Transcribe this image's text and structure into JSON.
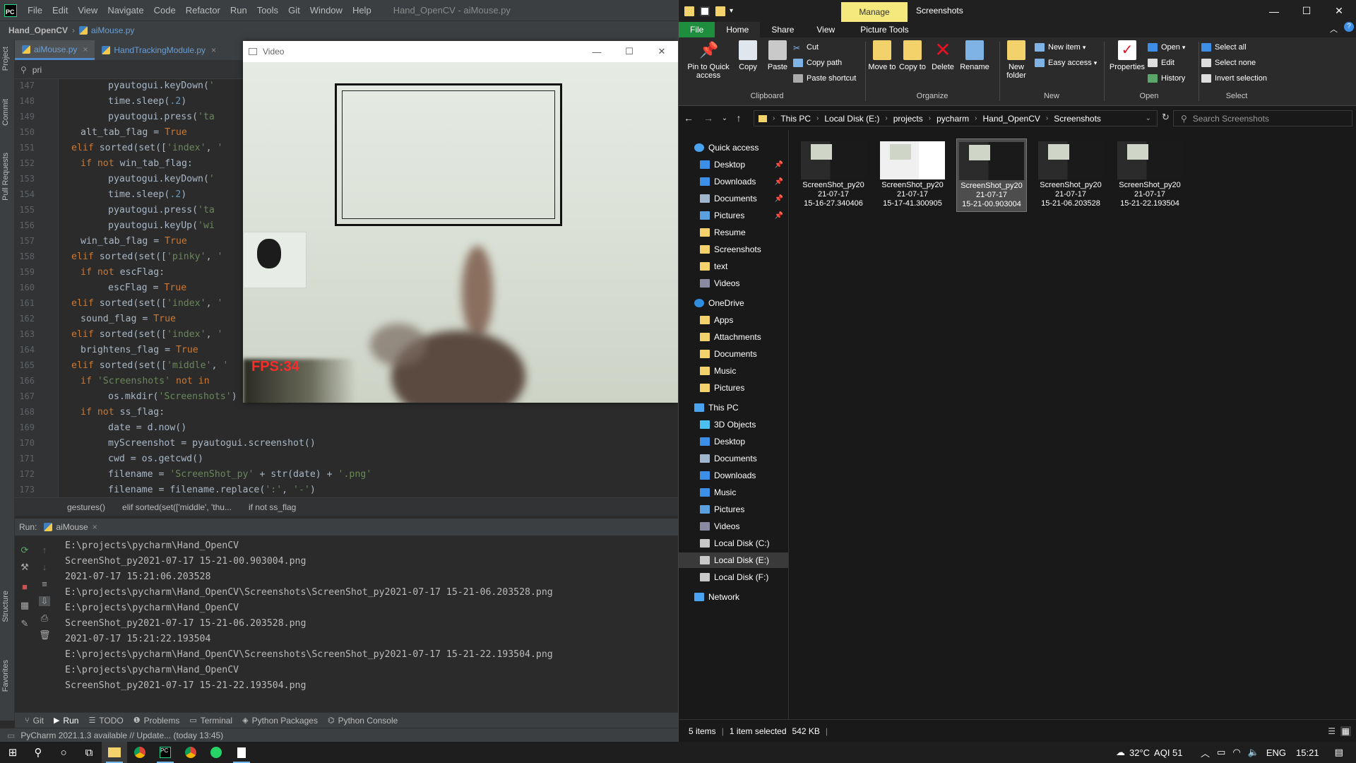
{
  "pycharm": {
    "menu": [
      "File",
      "Edit",
      "View",
      "Navigate",
      "Code",
      "Refactor",
      "Run",
      "Tools",
      "Git",
      "Window",
      "Help"
    ],
    "window_title": "Hand_OpenCV - aiMouse.py",
    "nav": {
      "project": "Hand_OpenCV",
      "file": "aiMouse.py"
    },
    "left_tabs": [
      "Project",
      "Commit",
      "Pull Requests",
      "Structure",
      "Favorites"
    ],
    "tabs": [
      {
        "label": "aiMouse.py",
        "active": true
      },
      {
        "label": "HandTrackingModule.py",
        "active": false
      }
    ],
    "search_text": "pri",
    "code_lines": [
      {
        "n": "147",
        "indent": 6,
        "text": "pyautogui.keyDown('"
      },
      {
        "n": "148",
        "indent": 6,
        "text": "time.sleep(.2)"
      },
      {
        "n": "149",
        "indent": 6,
        "text": "pyautogui.press('ta"
      },
      {
        "n": "150",
        "indent": 3,
        "text": "alt_tab_flag = True"
      },
      {
        "n": "151",
        "indent": 2,
        "text": "elif sorted(set(['index', '"
      },
      {
        "n": "152",
        "indent": 3,
        "text": "if not win_tab_flag:"
      },
      {
        "n": "153",
        "indent": 6,
        "text": "pyautogui.keyDown('"
      },
      {
        "n": "154",
        "indent": 6,
        "text": "time.sleep(.2)"
      },
      {
        "n": "155",
        "indent": 6,
        "text": "pyautogui.press('ta"
      },
      {
        "n": "156",
        "indent": 6,
        "text": "pyautogui.keyUp('wi"
      },
      {
        "n": "157",
        "indent": 3,
        "text": "win_tab_flag = True"
      },
      {
        "n": "158",
        "indent": 2,
        "text": "elif sorted(set(['pinky', '"
      },
      {
        "n": "159",
        "indent": 3,
        "text": "if not escFlag:"
      },
      {
        "n": "160",
        "indent": 6,
        "text": "escFlag = True"
      },
      {
        "n": "161",
        "indent": 2,
        "text": "elif sorted(set(['index', '"
      },
      {
        "n": "162",
        "indent": 3,
        "text": "sound_flag = True"
      },
      {
        "n": "163",
        "indent": 2,
        "text": "elif sorted(set(['index', '"
      },
      {
        "n": "164",
        "indent": 3,
        "text": "brightens_flag = True"
      },
      {
        "n": "165",
        "indent": 2,
        "text": "elif sorted(set(['middle', '"
      },
      {
        "n": "166",
        "indent": 3,
        "text": "if 'Screenshots' not in"
      },
      {
        "n": "167",
        "indent": 6,
        "text": "os.mkdir('Screenshots')"
      },
      {
        "n": "168",
        "indent": 3,
        "text": "if not ss_flag:"
      },
      {
        "n": "169",
        "indent": 6,
        "text": "date = d.now()"
      },
      {
        "n": "170",
        "indent": 6,
        "text": "myScreenshot = pyautogui.screenshot()"
      },
      {
        "n": "171",
        "indent": 6,
        "text": "cwd = os.getcwd()"
      },
      {
        "n": "172",
        "indent": 6,
        "text": "filename = 'ScreenShot_py' + str(date) + '.png'"
      },
      {
        "n": "173",
        "indent": 6,
        "text": "filename = filename.replace(':', '-')"
      }
    ],
    "breadcrumb": [
      "gestures()",
      "elif sorted(set(['middle', 'thu...",
      "if not ss_flag"
    ],
    "run_label": "Run:",
    "run_tab": "aiMouse",
    "console_lines": [
      "E:\\projects\\pycharm\\Hand_OpenCV",
      "ScreenShot_py2021-07-17 15-21-00.903004.png",
      "2021-07-17 15:21:06.203528",
      "E:\\projects\\pycharm\\Hand_OpenCV\\Screenshots\\ScreenShot_py2021-07-17 15-21-06.203528.png",
      "E:\\projects\\pycharm\\Hand_OpenCV",
      "ScreenShot_py2021-07-17 15-21-06.203528.png",
      "2021-07-17 15:21:22.193504",
      "E:\\projects\\pycharm\\Hand_OpenCV\\Screenshots\\ScreenShot_py2021-07-17 15-21-22.193504.png",
      "E:\\projects\\pycharm\\Hand_OpenCV",
      "ScreenShot_py2021-07-17 15-21-22.193504.png"
    ],
    "bottom_tabs": [
      {
        "label": "Git",
        "icon": "git-icon"
      },
      {
        "label": "Run",
        "icon": "run-icon",
        "active": true
      },
      {
        "label": "TODO",
        "icon": "todo-icon"
      },
      {
        "label": "Problems",
        "icon": "problems-icon"
      },
      {
        "label": "Terminal",
        "icon": "terminal-icon"
      },
      {
        "label": "Python Packages",
        "icon": "packages-icon"
      },
      {
        "label": "Python Console",
        "icon": "python-icon"
      }
    ],
    "status": "PyCharm 2021.1.3 available // Update... (today 13:45)"
  },
  "video": {
    "title": "Video",
    "fps": "FPS:34"
  },
  "explorer": {
    "manage_tab": "Manage",
    "title": "Screenshots",
    "ribbon_tabs": [
      "File",
      "Home",
      "Share",
      "View",
      "Picture Tools"
    ],
    "clipboard": {
      "pin": "Pin to Quick access",
      "copy": "Copy",
      "paste": "Paste",
      "cut": "Cut",
      "copy_path": "Copy path",
      "paste_shortcut": "Paste shortcut",
      "group": "Clipboard"
    },
    "organize": {
      "move": "Move to",
      "copy": "Copy to",
      "delete": "Delete",
      "rename": "Rename",
      "group": "Organize"
    },
    "new": {
      "folder": "New folder",
      "item": "New item",
      "easy": "Easy access",
      "group": "New"
    },
    "open": {
      "properties": "Properties",
      "open": "Open",
      "edit": "Edit",
      "history": "History",
      "group": "Open"
    },
    "select": {
      "all": "Select all",
      "none": "Select none",
      "invert": "Invert selection",
      "group": "Select"
    },
    "address": [
      "This PC",
      "Local Disk (E:)",
      "projects",
      "pycharm",
      "Hand_OpenCV",
      "Screenshots"
    ],
    "search_placeholder": "Search Screenshots",
    "nav_items": [
      {
        "label": "Quick access",
        "level": 0,
        "icon": "star-icon",
        "color": "#4aa3f0"
      },
      {
        "label": "Desktop",
        "level": 1,
        "icon": "desktop-icon",
        "color": "#3d8ee6",
        "pin": true
      },
      {
        "label": "Downloads",
        "level": 1,
        "icon": "download-icon",
        "color": "#3d8ee6",
        "pin": true
      },
      {
        "label": "Documents",
        "level": 1,
        "icon": "documents-icon",
        "color": "#9fb6cc",
        "pin": true
      },
      {
        "label": "Pictures",
        "level": 1,
        "icon": "pictures-icon",
        "color": "#5aa0e0",
        "pin": true
      },
      {
        "label": "Resume",
        "level": 1,
        "icon": "folder-icon",
        "color": "#f3d26b"
      },
      {
        "label": "Screenshots",
        "level": 1,
        "icon": "folder-icon",
        "color": "#f3d26b"
      },
      {
        "label": "text",
        "level": 1,
        "icon": "folder-icon",
        "color": "#f3d26b"
      },
      {
        "label": "Videos",
        "level": 1,
        "icon": "videos-icon",
        "color": "#8a8aa0"
      },
      {
        "label": "OneDrive",
        "level": 0,
        "icon": "cloud-icon",
        "color": "#2e8ee0"
      },
      {
        "label": "Apps",
        "level": 1,
        "icon": "folder-icon",
        "color": "#f3d26b"
      },
      {
        "label": "Attachments",
        "level": 1,
        "icon": "folder-icon",
        "color": "#f3d26b"
      },
      {
        "label": "Documents",
        "level": 1,
        "icon": "folder-icon",
        "color": "#f3d26b"
      },
      {
        "label": "Music",
        "level": 1,
        "icon": "folder-icon",
        "color": "#f3d26b"
      },
      {
        "label": "Pictures",
        "level": 1,
        "icon": "folder-icon",
        "color": "#f3d26b"
      },
      {
        "label": "This PC",
        "level": 0,
        "icon": "computer-icon",
        "color": "#4aa3f0"
      },
      {
        "label": "3D Objects",
        "level": 1,
        "icon": "cube-icon",
        "color": "#4ac0f0"
      },
      {
        "label": "Desktop",
        "level": 1,
        "icon": "desktop-icon",
        "color": "#3d8ee6"
      },
      {
        "label": "Documents",
        "level": 1,
        "icon": "documents-icon",
        "color": "#9fb6cc"
      },
      {
        "label": "Downloads",
        "level": 1,
        "icon": "download-icon",
        "color": "#3d8ee6"
      },
      {
        "label": "Music",
        "level": 1,
        "icon": "music-icon",
        "color": "#3d8ee6"
      },
      {
        "label": "Pictures",
        "level": 1,
        "icon": "pictures-icon",
        "color": "#5aa0e0"
      },
      {
        "label": "Videos",
        "level": 1,
        "icon": "videos-icon",
        "color": "#8a8aa0"
      },
      {
        "label": "Local Disk (C:)",
        "level": 1,
        "icon": "drive-icon",
        "color": "#c8c8c8"
      },
      {
        "label": "Local Disk (E:)",
        "level": 1,
        "icon": "drive-icon",
        "color": "#c8c8c8",
        "selected": true
      },
      {
        "label": "Local Disk (F:)",
        "level": 1,
        "icon": "drive-icon",
        "color": "#c8c8c8"
      },
      {
        "label": "Network",
        "level": 0,
        "icon": "network-icon",
        "color": "#4aa3f0"
      }
    ],
    "files": [
      {
        "line1": "ScreenShot_py20",
        "line2": "21-07-17",
        "line3": "15-16-27.340406",
        "selected": false
      },
      {
        "line1": "ScreenShot_py20",
        "line2": "21-07-17",
        "line3": "15-17-41.300905",
        "selected": false
      },
      {
        "line1": "ScreenShot_py20",
        "line2": "21-07-17",
        "line3": "15-21-00.903004",
        "selected": true
      },
      {
        "line1": "ScreenShot_py20",
        "line2": "21-07-17",
        "line3": "15-21-06.203528",
        "selected": false
      },
      {
        "line1": "ScreenShot_py20",
        "line2": "21-07-17",
        "line3": "15-21-22.193504",
        "selected": false
      }
    ],
    "status": {
      "items": "5 items",
      "selected": "1 item selected",
      "size": "542 KB"
    }
  },
  "taskbar": {
    "weather": "32°C",
    "aqi": "AQI 51",
    "lang": "ENG",
    "time": "15:21"
  },
  "colors": {
    "ide_bg": "#2b2b2b",
    "ide_panel": "#3c3f41",
    "explorer_bg": "#191919",
    "accent_green": "#1e8e3e",
    "manage_yellow": "#f5e97d",
    "fps_red": "#ff2a2a"
  }
}
